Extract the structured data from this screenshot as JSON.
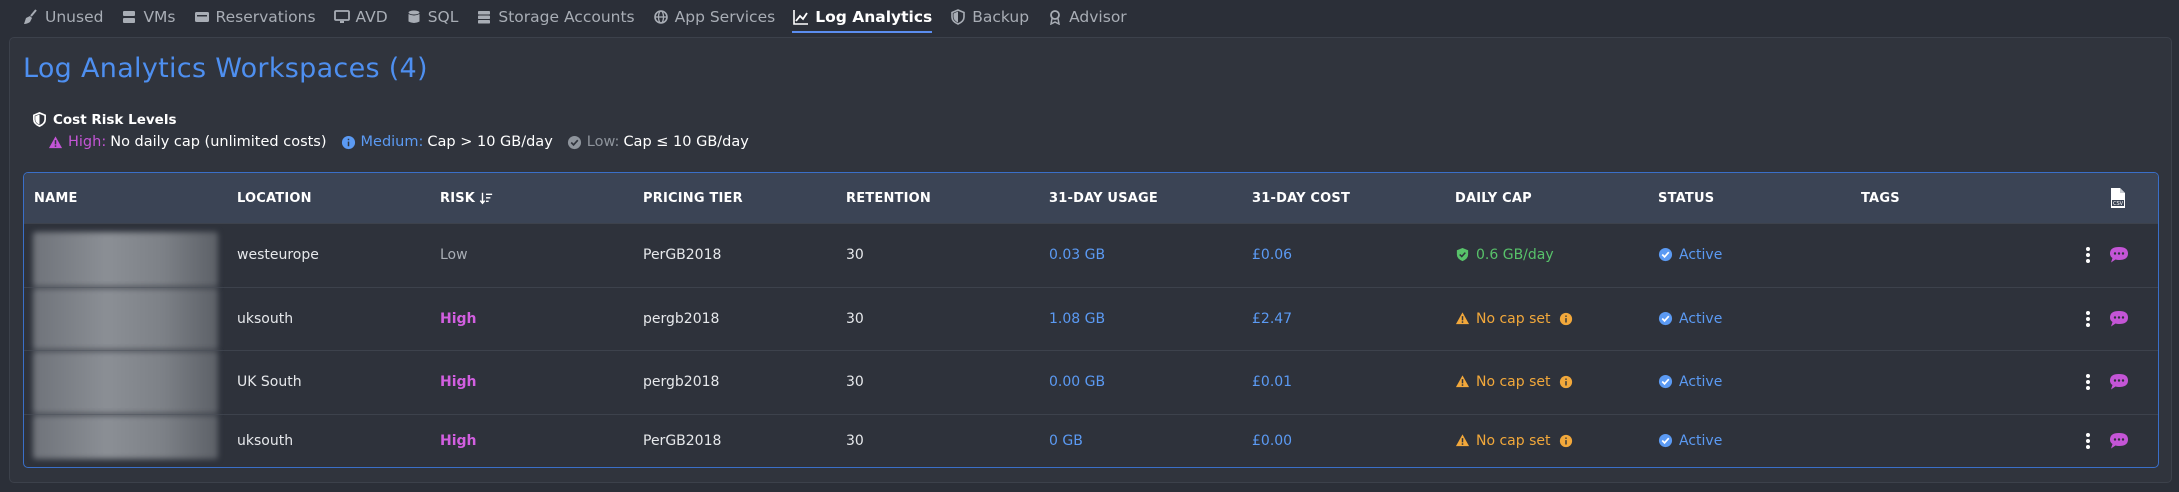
{
  "tabs": [
    {
      "label": "Unused",
      "icon": "broom-icon",
      "active": false
    },
    {
      "label": "VMs",
      "icon": "server-icon",
      "active": false
    },
    {
      "label": "Reservations",
      "icon": "reservation-icon",
      "active": false
    },
    {
      "label": "AVD",
      "icon": "desktop-icon",
      "active": false
    },
    {
      "label": "SQL",
      "icon": "database-icon",
      "active": false
    },
    {
      "label": "Storage Accounts",
      "icon": "storage-icon",
      "active": false
    },
    {
      "label": "App Services",
      "icon": "globe-icon",
      "active": false
    },
    {
      "label": "Log Analytics",
      "icon": "line-chart-icon",
      "active": true
    },
    {
      "label": "Backup",
      "icon": "shield-icon",
      "active": false
    },
    {
      "label": "Advisor",
      "icon": "award-icon",
      "active": false
    }
  ],
  "page": {
    "title": "Log Analytics Workspaces (4)"
  },
  "legend": {
    "heading": "Cost Risk Levels",
    "high_label": "High:",
    "high_desc": "No daily cap (unlimited costs)",
    "medium_label": "Medium:",
    "medium_desc": "Cap > 10 GB/day",
    "low_label": "Low:",
    "low_desc": "Cap ≤ 10 GB/day"
  },
  "table": {
    "headers": {
      "name": "NAME",
      "location": "LOCATION",
      "risk": "RISK",
      "pricing_tier": "PRICING TIER",
      "retention": "RETENTION",
      "usage": "31-DAY USAGE",
      "cost": "31-DAY COST",
      "daily_cap": "DAILY CAP",
      "status": "STATUS",
      "tags": "TAGS"
    },
    "rows": [
      {
        "location": "westeurope",
        "risk": "Low",
        "pricing_tier": "PerGB2018",
        "retention": "30",
        "usage": "0.03 GB",
        "cost": "£0.06",
        "daily_cap": "0.6 GB/day",
        "cap_set": true,
        "status": "Active"
      },
      {
        "location": "uksouth",
        "risk": "High",
        "pricing_tier": "pergb2018",
        "retention": "30",
        "usage": "1.08 GB",
        "cost": "£2.47",
        "daily_cap": "No cap set",
        "cap_set": false,
        "status": "Active"
      },
      {
        "location": "UK South",
        "risk": "High",
        "pricing_tier": "pergb2018",
        "retention": "30",
        "usage": "0.00 GB",
        "cost": "£0.01",
        "daily_cap": "No cap set",
        "cap_set": false,
        "status": "Active"
      },
      {
        "location": "uksouth",
        "risk": "High",
        "pricing_tier": "PerGB2018",
        "retention": "30",
        "usage": "0 GB",
        "cost": "£0.00",
        "daily_cap": "No cap set",
        "cap_set": false,
        "status": "Active"
      }
    ]
  },
  "colors": {
    "accent": "#4e8ff0",
    "high": "#d25fe0",
    "low": "#a9aeb5",
    "ok": "#58c26a",
    "warn": "#f2a83b",
    "action": "#c455d6"
  }
}
